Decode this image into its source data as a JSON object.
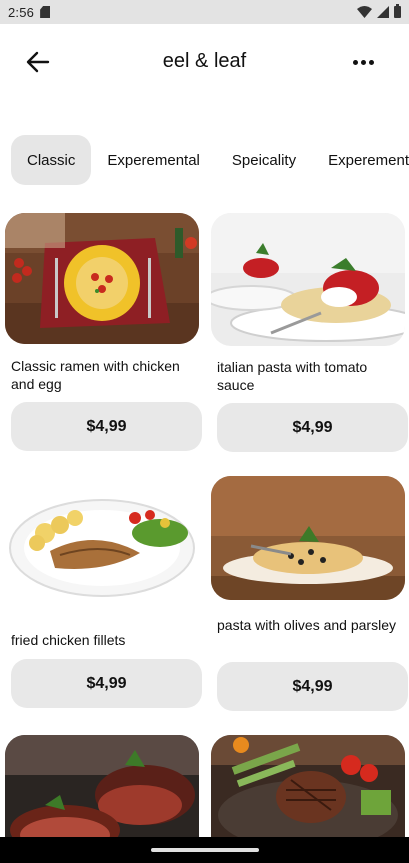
{
  "status_bar": {
    "time": "2:56",
    "icons": [
      "sd-card-icon",
      "wifi-icon",
      "signal-icon",
      "battery-icon"
    ]
  },
  "app_bar": {
    "title": "eel & leaf",
    "back_icon": "arrow-left-icon",
    "more_icon": "more-horizontal-icon"
  },
  "tabs": [
    {
      "label": "Classic",
      "active": true
    },
    {
      "label": "Experemental",
      "active": false
    },
    {
      "label": "Speicality",
      "active": false
    },
    {
      "label": "Experemental",
      "active": false
    }
  ],
  "menu_items": [
    {
      "name": "Classic ramen with chicken and egg",
      "price": "$4,99"
    },
    {
      "name": "italian pasta with tomato sauce",
      "price": "$4,99"
    },
    {
      "name": "fried chicken fillets",
      "price": "$4,99"
    },
    {
      "name": "pasta with olives and parsley",
      "price": "$4,99"
    },
    {
      "name": "",
      "price": ""
    },
    {
      "name": "",
      "price": ""
    }
  ],
  "colors": {
    "status_bar_bg": "#e3e3e3",
    "chip_active_bg": "#e6e6e6",
    "price_button_bg": "#e8e8e8",
    "nav_bar_bg": "#000000"
  }
}
